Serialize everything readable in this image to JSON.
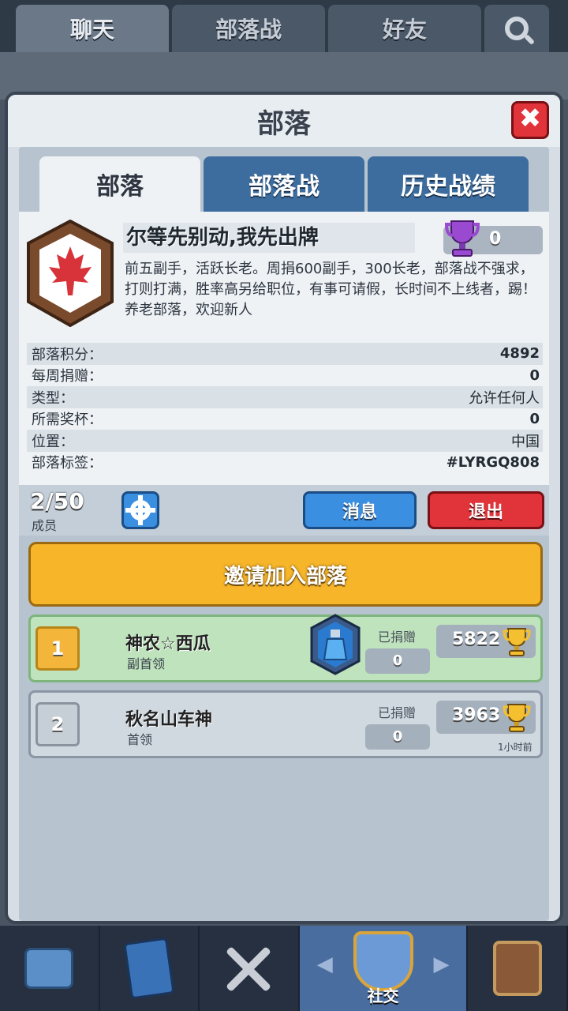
{
  "top_tabs": [
    {
      "label": "聊天",
      "active": true
    },
    {
      "label": "部落战",
      "active": false
    },
    {
      "label": "好友",
      "active": false
    }
  ],
  "modal": {
    "title": "部落",
    "close_label": "✖"
  },
  "tabs": [
    {
      "label": "部落",
      "active": true
    },
    {
      "label": "部落战",
      "active": false
    },
    {
      "label": "历史战绩",
      "active": false
    }
  ],
  "clan": {
    "name": "尔等先别动,我先出牌",
    "war_trophies": "0",
    "description": "前五副手，活跃长老。周捐600副手，300长老，部落战不强求，打则打满，胜率高另给职位，有事可请假，长时间不上线者，踢！养老部落，欢迎新人",
    "stats": [
      {
        "label": "部落积分：",
        "value": "4892"
      },
      {
        "label": "每周捐赠：",
        "value": "0"
      },
      {
        "label": "类型：",
        "value": "允许任何人"
      },
      {
        "label": "所需奖杯：",
        "value": "0"
      },
      {
        "label": "位置：",
        "value": "中国"
      },
      {
        "label": "部落标签：",
        "value": "#LYRGQ808"
      }
    ]
  },
  "members_bar": {
    "count": "2/50",
    "label": "成员",
    "message_btn": "消息",
    "exit_btn": "退出"
  },
  "invite_btn": "邀请加入部落",
  "members": [
    {
      "rank": "1",
      "name": "神农☆西瓜",
      "role": "副首领",
      "donated_label": "已捐赠",
      "donated": "0",
      "trophies": "5822",
      "last_seen": ""
    },
    {
      "rank": "2",
      "name": "秋名山车神",
      "role": "首领",
      "donated_label": "已捐赠",
      "donated": "0",
      "trophies": "3963",
      "last_seen": "1小时前"
    }
  ],
  "bottom_nav": {
    "social_label": "社交"
  },
  "colors": {
    "accent_blue": "#3a8fe0",
    "exit_red": "#e0333a",
    "invite_gold": "#f7b52a",
    "member_me_green": "#bfe3bd"
  }
}
